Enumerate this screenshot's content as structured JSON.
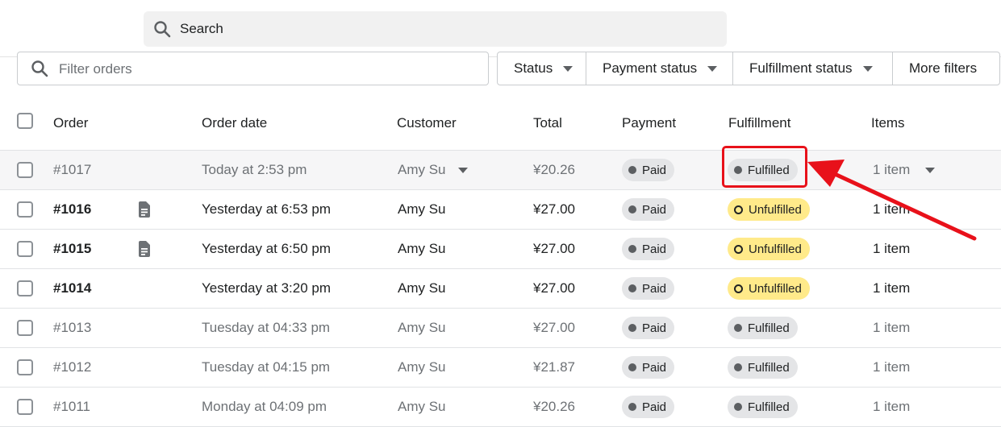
{
  "search": {
    "placeholder": "Search",
    "icon": "search-icon"
  },
  "filters": {
    "filter_placeholder": "Filter orders",
    "buttons": [
      "Status",
      "Payment status",
      "Fulfillment status",
      "More filters"
    ]
  },
  "table": {
    "columns": [
      "Order",
      "Order date",
      "Customer",
      "Total",
      "Payment",
      "Fulfillment",
      "Items"
    ],
    "rows": [
      {
        "order": "#1017",
        "date": "Today at 2:53 pm",
        "customer": "Amy Su",
        "total": "¥20.26",
        "payment": "Paid",
        "fulfillment": "Fulfilled",
        "items": "1 item",
        "has_note": false,
        "unread": false
      },
      {
        "order": "#1016",
        "date": "Yesterday at 6:53 pm",
        "customer": "Amy Su",
        "total": "¥27.00",
        "payment": "Paid",
        "fulfillment": "Unfulfilled",
        "items": "1 item",
        "has_note": true,
        "unread": true
      },
      {
        "order": "#1015",
        "date": "Yesterday at 6:50 pm",
        "customer": "Amy Su",
        "total": "¥27.00",
        "payment": "Paid",
        "fulfillment": "Unfulfilled",
        "items": "1 item",
        "has_note": true,
        "unread": true
      },
      {
        "order": "#1014",
        "date": "Yesterday at 3:20 pm",
        "customer": "Amy Su",
        "total": "¥27.00",
        "payment": "Paid",
        "fulfillment": "Unfulfilled",
        "items": "1 item",
        "has_note": false,
        "unread": true
      },
      {
        "order": "#1013",
        "date": "Tuesday at 04:33 pm",
        "customer": "Amy Su",
        "total": "¥27.00",
        "payment": "Paid",
        "fulfillment": "Fulfilled",
        "items": "1 item",
        "has_note": false,
        "unread": false
      },
      {
        "order": "#1012",
        "date": "Tuesday at 04:15 pm",
        "customer": "Amy Su",
        "total": "¥21.87",
        "payment": "Paid",
        "fulfillment": "Fulfilled",
        "items": "1 item",
        "has_note": false,
        "unread": false
      },
      {
        "order": "#1011",
        "date": "Monday at 04:09 pm",
        "customer": "Amy Su",
        "total": "¥20.26",
        "payment": "Paid",
        "fulfillment": "Fulfilled",
        "items": "1 item",
        "has_note": false,
        "unread": false
      }
    ]
  },
  "colors": {
    "badge_gray": "#e4e5e7",
    "badge_yellow": "#ffea8a",
    "annotation_red": "#e8111a"
  }
}
